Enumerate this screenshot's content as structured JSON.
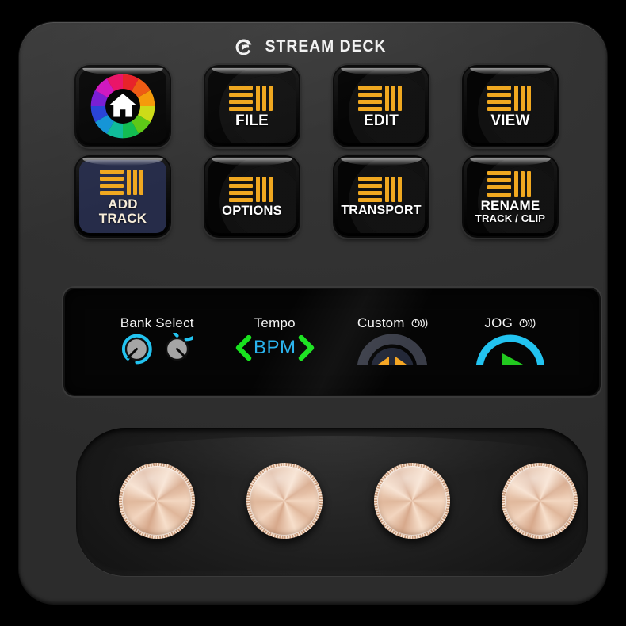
{
  "device": {
    "brand": "STREAM DECK",
    "logo_icon": "elgato-logo-icon",
    "body_color": "#333333",
    "background_color": "#000000"
  },
  "keys": [
    {
      "id": "home",
      "icon": "color-wheel-home-icon",
      "label_1": "",
      "label_2": "",
      "bg": "#050505",
      "text_color": "#ffffff"
    },
    {
      "id": "file",
      "icon": "menu-bars-icon",
      "label_1": "FILE",
      "label_2": "",
      "bg": "#050505",
      "text_color": "#ffffff"
    },
    {
      "id": "edit",
      "icon": "menu-bars-icon",
      "label_1": "EDIT",
      "label_2": "",
      "bg": "#050505",
      "text_color": "#ffffff"
    },
    {
      "id": "view",
      "icon": "menu-bars-icon",
      "label_1": "VIEW",
      "label_2": "",
      "bg": "#050505",
      "text_color": "#ffffff"
    },
    {
      "id": "add-track",
      "icon": "menu-bars-icon",
      "label_1": "ADD",
      "label_2": "TRACK",
      "bg": "#262c49",
      "text_color": "#f6ecd9"
    },
    {
      "id": "options",
      "icon": "menu-bars-icon",
      "label_1": "OPTIONS",
      "label_2": "",
      "bg": "#050505",
      "text_color": "#ffffff"
    },
    {
      "id": "transport",
      "icon": "menu-bars-icon",
      "label_1": "TRANSPORT",
      "label_2": "",
      "bg": "#050505",
      "text_color": "#ffffff"
    },
    {
      "id": "rename",
      "icon": "menu-bars-icon",
      "label_1": "RENAME",
      "label_2": "TRACK / CLIP",
      "bg": "#050505",
      "text_color": "#ffffff"
    }
  ],
  "key_icon_color": "#f0a820",
  "lcd": {
    "cells": [
      {
        "id": "bank-select",
        "title": "Bank Select",
        "dial_icon": "",
        "widget": "dual-knobs",
        "value": "",
        "accent": "#22c3f0"
      },
      {
        "id": "tempo",
        "title": "Tempo",
        "dial_icon": "",
        "widget": "bpm-stepper",
        "value": "BPM",
        "accent": "#2ab4ef",
        "chevron_color": "#18e21e"
      },
      {
        "id": "custom",
        "title": "Custom",
        "dial_icon": "dial-icon",
        "widget": "custom-arrows",
        "value": "",
        "accent": "#f5a623"
      },
      {
        "id": "jog",
        "title": "JOG",
        "dial_icon": "dial-icon",
        "widget": "jog-play",
        "value": "",
        "accent": "#22c3f0",
        "play_color": "#22c91f"
      }
    ]
  },
  "knobs": [
    {
      "id": "knob-1",
      "name": "encoder-knob-1"
    },
    {
      "id": "knob-2",
      "name": "encoder-knob-2"
    },
    {
      "id": "knob-3",
      "name": "encoder-knob-3"
    },
    {
      "id": "knob-4",
      "name": "encoder-knob-4"
    }
  ]
}
